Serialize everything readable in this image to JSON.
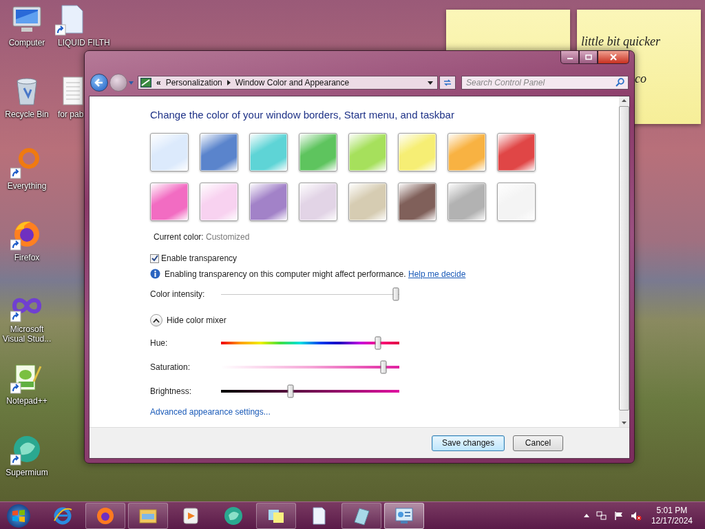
{
  "desktop": {
    "icons": [
      {
        "label": "Computer",
        "kind": "computer",
        "shortcut": false
      },
      {
        "label": "Recycle Bin",
        "kind": "recycle-bin",
        "shortcut": false
      },
      {
        "label": "Everything",
        "kind": "ring",
        "shortcut": true
      },
      {
        "label": "Firefox",
        "kind": "firefox",
        "shortcut": true
      },
      {
        "label": "Microsoft Visual Stud...",
        "kind": "infinity",
        "shortcut": true
      },
      {
        "label": "Notepad++",
        "kind": "notepad",
        "shortcut": true
      },
      {
        "label": "Supermium",
        "kind": "supermium",
        "shortcut": true
      },
      {
        "label": "LIQUID FILTH",
        "kind": "document",
        "shortcut": true
      },
      {
        "label": "for pab",
        "kind": "lined-document",
        "shortcut": false
      }
    ]
  },
  "sticky_notes": [
    {
      "lines": [
        "little bit quicker",
        "co"
      ]
    }
  ],
  "window": {
    "address": {
      "overflow": "«",
      "crumbs": [
        "Personalization",
        "Window Color and Appearance"
      ]
    },
    "search": {
      "placeholder": "Search Control Panel"
    },
    "heading": "Change the color of your window borders, Start menu, and taskbar",
    "swatches": [
      {
        "color": "#dceafc",
        "selected": false
      },
      {
        "color": "#5a84cc",
        "selected": false
      },
      {
        "color": "#5ed4d6",
        "selected": false
      },
      {
        "color": "#5ec45e",
        "selected": false
      },
      {
        "color": "#a6e05c",
        "selected": false
      },
      {
        "color": "#f6ee74",
        "selected": false
      },
      {
        "color": "#f8b242",
        "selected": false
      },
      {
        "color": "#e04646",
        "selected": false
      },
      {
        "color": "#f26cc2",
        "selected": false
      },
      {
        "color": "#f8d2f0",
        "selected": false
      },
      {
        "color": "#a282c8",
        "selected": false
      },
      {
        "color": "#e2d4e6",
        "selected": false
      },
      {
        "color": "#d6ccb2",
        "selected": false
      },
      {
        "color": "#80605a",
        "selected": false
      },
      {
        "color": "#b2b2b2",
        "selected": false
      },
      {
        "color": "#f4f4f4",
        "selected": false
      }
    ],
    "current_color": {
      "label": "Current color:",
      "value": "Customized"
    },
    "transparency": {
      "label": "Enable transparency",
      "checked": true
    },
    "info": {
      "text": "Enabling transparency on this computer might affect performance.",
      "link": "Help me decide"
    },
    "intensity": {
      "label": "Color intensity:",
      "kind": "plain",
      "level": 0.98
    },
    "mixer": {
      "label": "Hide color mixer",
      "expanded": true
    },
    "sliders": [
      {
        "label": "Hue:",
        "kind": "hue",
        "level": 0.88
      },
      {
        "label": "Saturation:",
        "kind": "saturation",
        "level": 0.91
      },
      {
        "label": "Brightness:",
        "kind": "brightness",
        "level": 0.39
      }
    ],
    "advanced_link": "Advanced appearance settings...",
    "buttons": [
      {
        "label": "Save changes",
        "default": true
      },
      {
        "label": "Cancel",
        "default": false
      }
    ]
  },
  "taskbar": {
    "items": [
      {
        "kind": "ie",
        "open": false,
        "selected": false
      },
      {
        "kind": "firefox",
        "open": true,
        "selected": false
      },
      {
        "kind": "folder",
        "open": true,
        "selected": false
      },
      {
        "kind": "media",
        "open": false,
        "selected": false
      },
      {
        "kind": "supermium",
        "open": false,
        "selected": false
      },
      {
        "kind": "sticky",
        "open": true,
        "selected": false
      },
      {
        "kind": "document",
        "open": false,
        "selected": false
      },
      {
        "kind": "notepad",
        "open": true,
        "selected": false
      },
      {
        "kind": "control-panel",
        "open": true,
        "selected": true
      }
    ],
    "time": "5:01 PM",
    "date": "12/17/2024"
  }
}
